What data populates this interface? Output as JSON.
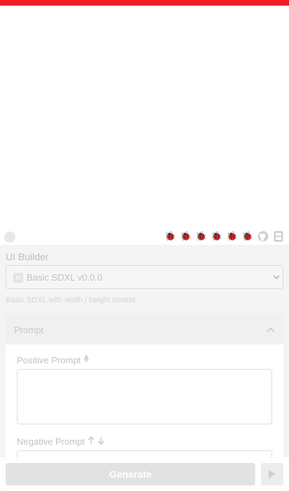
{
  "app": {
    "accent_color": "#ee1c25"
  },
  "toolbar": {
    "icons": [
      "bug-icon",
      "bug-icon",
      "bug-icon",
      "bug-icon",
      "bug-icon",
      "bug-icon",
      "github-icon",
      "badge-icon"
    ]
  },
  "builder": {
    "label": "UI Builder",
    "selected": "Basic SDXL v0.0.0",
    "helper": "Basic SDXL with width / height control"
  },
  "prompt_panel": {
    "title": "Prompt",
    "positive_label": "Positive Prompt",
    "negative_label": "Negative Prompt",
    "positive_value": "",
    "negative_value": ""
  },
  "actions": {
    "generate_label": "Generate"
  }
}
